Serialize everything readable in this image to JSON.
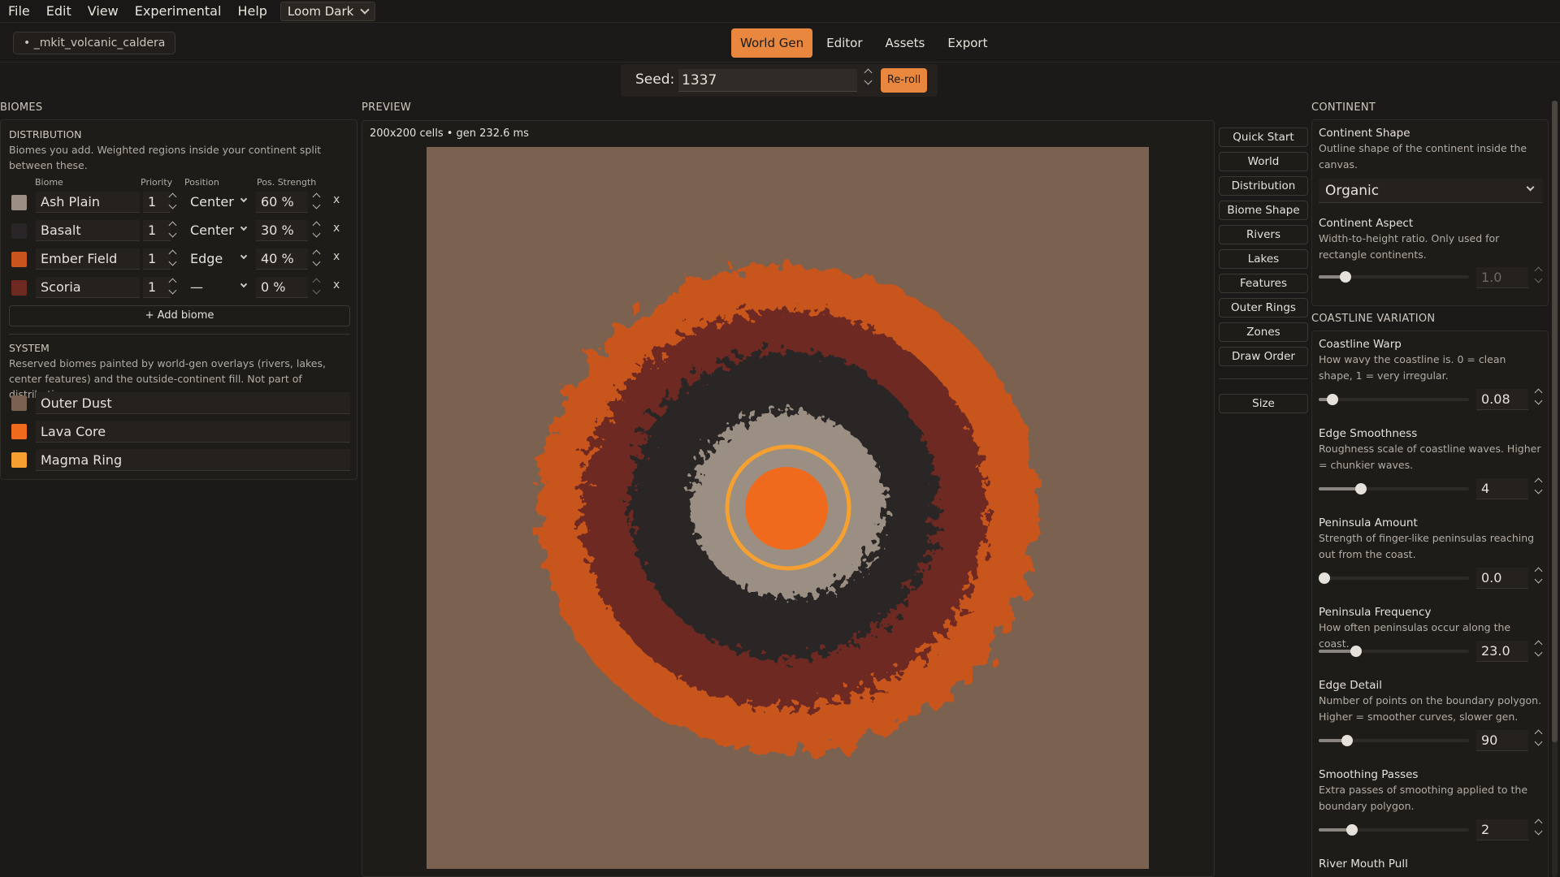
{
  "menu": {
    "items": [
      "File",
      "Edit",
      "View",
      "Experimental",
      "Help"
    ],
    "theme": "Loom Dark"
  },
  "project": {
    "name": "• _mkit_volcanic_caldera"
  },
  "tabs": [
    "World Gen",
    "Editor",
    "Assets",
    "Export"
  ],
  "active_tab": "World Gen",
  "seed": {
    "label": "Seed:",
    "value": "1337",
    "reroll_label": "Re-roll"
  },
  "biomes": {
    "section_title": "BIOMES",
    "distribution": {
      "title": "DISTRIBUTION",
      "description": "Biomes you add. Weighted regions inside your continent split between these.",
      "columns": [
        "Biome",
        "Priority",
        "Position",
        "Pos. Strength"
      ],
      "rows": [
        {
          "name": "Ash Plain",
          "priority": "1",
          "position": "Center",
          "strength": "60 %",
          "color": "#9b8e82"
        },
        {
          "name": "Basalt",
          "priority": "1",
          "position": "Center",
          "strength": "30 %",
          "color": "#2a2628"
        },
        {
          "name": "Ember Field",
          "priority": "1",
          "position": "Edge",
          "strength": "40 %",
          "color": "#c8541e"
        },
        {
          "name": "Scoria",
          "priority": "1",
          "position": "—",
          "strength": "0 %",
          "color": "#6e2a20"
        }
      ],
      "remove_label": "x",
      "add_label": "+ Add biome"
    },
    "system": {
      "title": "SYSTEM",
      "description": "Reserved biomes painted by world-gen overlays (rivers, lakes, center features) and the outside-continent fill. Not part of distribution.",
      "rows": [
        {
          "name": "Outer Dust",
          "color": "#7a6150"
        },
        {
          "name": "Lava Core",
          "color": "#f06a1e"
        },
        {
          "name": "Magma Ring",
          "color": "#f5a030"
        }
      ]
    }
  },
  "preview": {
    "section_title": "PREVIEW",
    "info": "200x200 cells • gen 232.6 ms"
  },
  "side_nav": [
    "Quick Start",
    "World",
    "Distribution",
    "Biome Shape",
    "Rivers",
    "Lakes",
    "Features",
    "Outer Rings",
    "Zones",
    "Draw Order"
  ],
  "size_label": "Size",
  "continent": {
    "section_title": "CONTINENT",
    "shape": {
      "title": "Continent Shape",
      "description": "Outline shape of the continent inside the canvas.",
      "value": "Organic"
    },
    "aspect": {
      "title": "Continent Aspect",
      "description": "Width-to-height ratio. Only used for rectangle continents.",
      "value": "1.0",
      "level": 0.18
    }
  },
  "coastline": {
    "section_title": "COASTLINE VARIATION",
    "params": [
      {
        "title": "Coastline Warp",
        "description": "How wavy the coastline is. 0 = clean shape, 1 = very irregular.",
        "value": "0.08",
        "level": 0.09
      },
      {
        "title": "Edge Smoothness",
        "description": "Roughness scale of coastline waves. Higher = chunkier waves.",
        "value": "4",
        "level": 0.28
      },
      {
        "title": "Peninsula Amount",
        "description": "Strength of finger-like peninsulas reaching out from the coast.",
        "value": "0.0",
        "level": 0.0
      },
      {
        "title": "Peninsula Frequency",
        "description": "How often peninsulas occur along the coast.",
        "value": "23.0",
        "level": 0.25
      },
      {
        "title": "Edge Detail",
        "description": "Number of points on the boundary polygon. Higher = smoother curves, slower gen.",
        "value": "90",
        "level": 0.19
      },
      {
        "title": "Smoothing Passes",
        "description": "Extra passes of smoothing applied to the boundary polygon.",
        "value": "2",
        "level": 0.22
      },
      {
        "title": "River Mouth Pull",
        "description": "",
        "value": "",
        "level": 0
      }
    ]
  },
  "colors": {
    "accent": "#e8873d",
    "outer_dust": "#7a6150",
    "ember": "#c8541e",
    "scoria": "#6e2a20",
    "basalt": "#2a2628",
    "ash": "#9b8e82",
    "magma_ring": "#f5a030",
    "lava_core": "#f06a1e"
  }
}
